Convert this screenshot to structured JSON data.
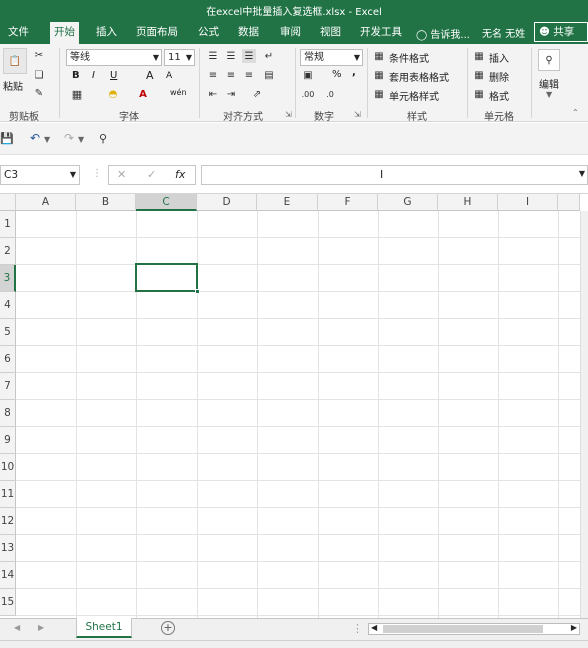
{
  "window": {
    "title": "在excel中批量插入复选框.xlsx - Excel"
  },
  "tabs": [
    "文件",
    "开始",
    "插入",
    "页面布局",
    "公式",
    "数据",
    "审阅",
    "视图",
    "开发工具"
  ],
  "active_tab": "开始",
  "tell_me": "告诉我...",
  "user": "无名 无姓",
  "share_label": "共享",
  "ribbon": {
    "clipboard": {
      "label": "剪贴板",
      "paste": "粘贴"
    },
    "font": {
      "label": "字体",
      "name": "等线",
      "size": "11",
      "bold": "B",
      "italic": "I",
      "underline": "U",
      "grow": "A",
      "shrink": "A",
      "wen": "wén"
    },
    "alignment": {
      "label": "对齐方式"
    },
    "number": {
      "label": "数字",
      "format": "常规",
      "percent": "%",
      "comma": ","
    },
    "styles": {
      "label": "样式",
      "conditional": "条件格式",
      "table": "套用表格格式",
      "cell": "单元格样式"
    },
    "cells": {
      "label": "单元格",
      "insert": "插入",
      "delete": "删除",
      "format": "格式"
    },
    "editing": {
      "label": "编辑"
    }
  },
  "formula_bar": {
    "name_box": "C3",
    "fx": "fx",
    "value": ""
  },
  "columns": [
    "A",
    "B",
    "C",
    "D",
    "E",
    "F",
    "G",
    "H",
    "I"
  ],
  "rows": [
    "1",
    "2",
    "3",
    "4",
    "5",
    "6",
    "7",
    "8",
    "9",
    "10",
    "11",
    "12",
    "13",
    "14",
    "15"
  ],
  "selected_cell": "C3",
  "sheets": [
    "Sheet1"
  ],
  "colors": {
    "accent": "#217346",
    "ribbon_bg": "#f3f3f3"
  }
}
